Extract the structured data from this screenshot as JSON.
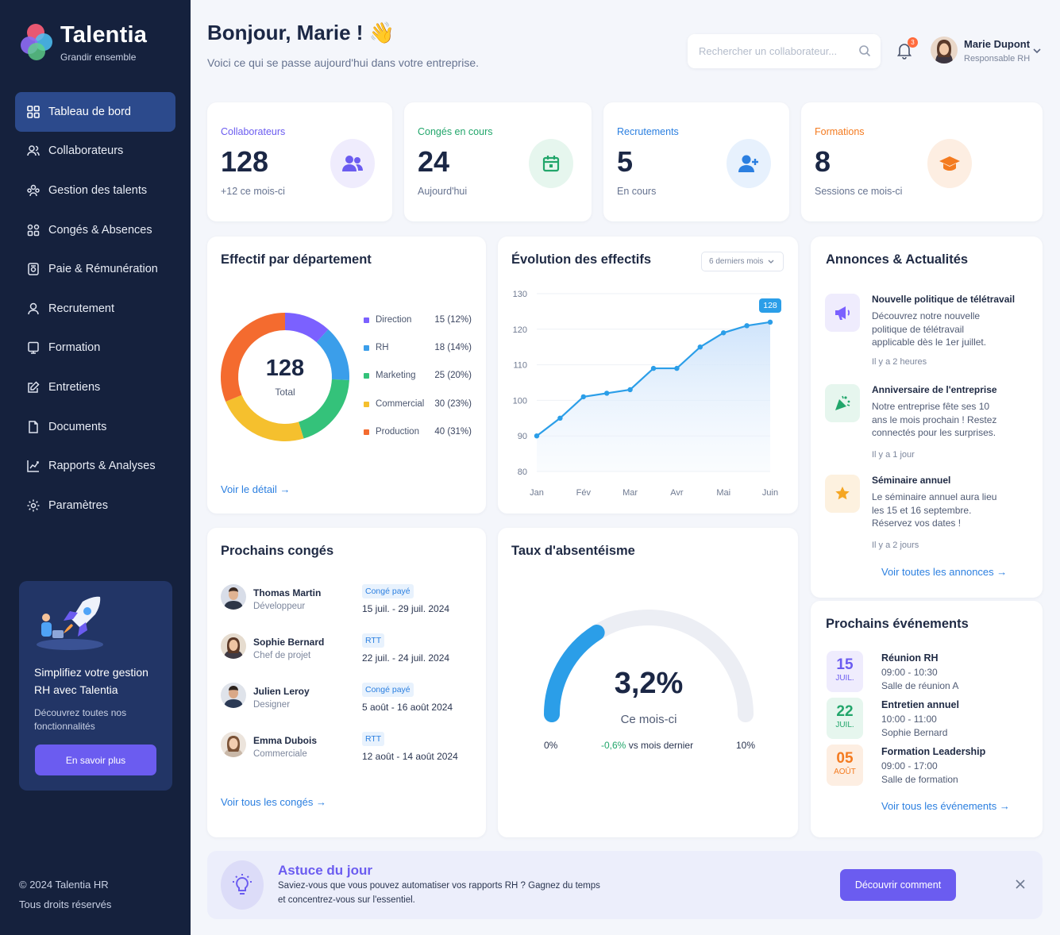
{
  "app": {
    "name": "Talentia",
    "tagline": "Grandir ensemble",
    "copyright": "© 2024 Talentia HR",
    "rights": "Tous droits réservés"
  },
  "colors": {
    "sidebar": "#15213d",
    "accent": "#6b5cf0",
    "link": "#2b7fe0",
    "positive": "#22a66b"
  },
  "nav": [
    {
      "label": "Tableau de bord",
      "icon": "grid-icon",
      "active": true
    },
    {
      "label": "Collaborateurs",
      "icon": "users-icon"
    },
    {
      "label": "Gestion des talents",
      "icon": "talents-icon"
    },
    {
      "label": "Congés & Absences",
      "icon": "calendar-grid-icon"
    },
    {
      "label": "Paie & Rémunération",
      "icon": "payroll-icon"
    },
    {
      "label": "Recrutement",
      "icon": "user-icon"
    },
    {
      "label": "Formation",
      "icon": "training-icon"
    },
    {
      "label": "Entretiens",
      "icon": "edit-icon"
    },
    {
      "label": "Documents",
      "icon": "document-icon"
    },
    {
      "label": "Rapports & Analyses",
      "icon": "report-icon"
    },
    {
      "label": "Paramètres",
      "icon": "gear-icon"
    }
  ],
  "promo": {
    "title": "Simplifiez votre gestion RH avec Talentia",
    "text": "Découvrez toutes nos fonctionnalités",
    "button": "En savoir plus"
  },
  "header": {
    "greeting": "Bonjour, Marie ! 👋",
    "subtitle": "Voici ce qui se passe aujourd'hui dans votre entreprise.",
    "search_placeholder": "Rechercher un collaborateur...",
    "notifications": "3",
    "user_name": "Marie Dupont",
    "user_role": "Responsable RH"
  },
  "stats": [
    {
      "label": "Collaborateurs",
      "value": "128",
      "sub": "+12 ce mois-ci",
      "color": "#6b5cf0",
      "bg": "#efecfd",
      "icon": "users-icon"
    },
    {
      "label": "Congés en cours",
      "value": "24",
      "sub": "Aujourd'hui",
      "color": "#22a66b",
      "bg": "#e6f6ee",
      "icon": "calendar-icon"
    },
    {
      "label": "Recrutements",
      "value": "5",
      "sub": "En cours",
      "color": "#2b7fe0",
      "bg": "#e7f1fd",
      "icon": "user-plus-icon"
    },
    {
      "label": "Formations",
      "value": "8",
      "sub": "Sessions ce mois-ci",
      "color": "#f47b20",
      "bg": "#fdeee2",
      "icon": "graduation-cap-icon"
    }
  ],
  "departments": {
    "title": "Effectif par département",
    "total": "128",
    "total_label": "Total",
    "link": "Voir le détail",
    "chart_data": {
      "type": "pie",
      "categories": [
        "Direction",
        "RH",
        "Marketing",
        "Commercial",
        "Production"
      ],
      "values": [
        15,
        18,
        25,
        30,
        40
      ],
      "labels": [
        "15 (12%)",
        "18 (14%)",
        "25 (20%)",
        "30 (23%)",
        "40 (31%)"
      ],
      "colors": [
        "#7b61ff",
        "#3b9eea",
        "#34c27a",
        "#f5c02e",
        "#f46b2f"
      ]
    }
  },
  "evolution": {
    "title": "Évolution des effectifs",
    "period": "6 derniers mois",
    "last_label": "128",
    "chart_data": {
      "type": "area",
      "x": [
        0,
        0.5,
        1,
        1.5,
        2,
        2.5,
        3,
        3.5,
        4,
        4.5,
        5
      ],
      "values": [
        90,
        95,
        101,
        102,
        103,
        109,
        109,
        115,
        119,
        121,
        122
      ],
      "xticks": [
        "Jan",
        "Fév",
        "Mar",
        "Avr",
        "Mai",
        "Juin"
      ],
      "yticks": [
        80,
        90,
        100,
        110,
        120,
        130
      ],
      "ylim": [
        80,
        130
      ]
    }
  },
  "news": {
    "title": "Annonces & Actualités",
    "link": "Voir toutes les annonces",
    "items": [
      {
        "title": "Nouvelle politique de télétravail",
        "text": "Découvrez notre nouvelle politique de télétravail applicable dès le 1er juillet.",
        "ago": "Il y a 2 heures",
        "icon": "megaphone-icon",
        "color": "#7b61ff",
        "bg": "#efecfd"
      },
      {
        "title": "Anniversaire de l'entreprise",
        "text": "Notre entreprise fête ses 10 ans le mois prochain ! Restez connectés pour les surprises.",
        "ago": "Il y a 1 jour",
        "icon": "party-icon",
        "color": "#22a66b",
        "bg": "#e6f6ee"
      },
      {
        "title": "Séminaire annuel",
        "text": "Le séminaire annuel aura lieu les 15 et 16 septembre. Réservez vos dates !",
        "ago": "Il y a 2 jours",
        "icon": "star-icon",
        "color": "#f5a623",
        "bg": "#fdf1df"
      }
    ]
  },
  "leaves": {
    "title": "Prochains congés",
    "link": "Voir tous les congés",
    "items": [
      {
        "name": "Thomas Martin",
        "role": "Développeur",
        "type": "Congé payé",
        "dates": "15 juil. - 29 juil. 2024"
      },
      {
        "name": "Sophie Bernard",
        "role": "Chef de projet",
        "type": "RTT",
        "dates": "22 juil. - 24 juil. 2024"
      },
      {
        "name": "Julien Leroy",
        "role": "Designer",
        "type": "Congé payé",
        "dates": "5 août - 16 août 2024"
      },
      {
        "name": "Emma Dubois",
        "role": "Commerciale",
        "type": "RTT",
        "dates": "12 août - 14 août 2024"
      }
    ]
  },
  "absence": {
    "title": "Taux d'absentéisme",
    "value": "3,2%",
    "value_num": 3.2,
    "max": 10,
    "sub": "Ce mois-ci",
    "min_label": "0%",
    "max_label": "10%",
    "delta": "-0,6%",
    "delta_text": "vs mois dernier"
  },
  "events": {
    "title": "Prochains événements",
    "link": "Voir tous les événements",
    "items": [
      {
        "day": "15",
        "month": "JUIL.",
        "title": "Réunion RH",
        "hours": "09:00 - 10:30",
        "place": "Salle de réunion A",
        "color": "#6b5cf0",
        "bg": "#efecfd"
      },
      {
        "day": "22",
        "month": "JUIL.",
        "title": "Entretien annuel",
        "hours": "10:00 - 11:00",
        "place": "Sophie Bernard",
        "color": "#22a66b",
        "bg": "#e6f6ee"
      },
      {
        "day": "05",
        "month": "AOÛT",
        "title": "Formation Leadership",
        "hours": "09:00 - 17:00",
        "place": "Salle de formation",
        "color": "#f47b20",
        "bg": "#fdeee2"
      }
    ]
  },
  "tip": {
    "title": "Astuce du jour",
    "line1": "Saviez-vous que vous pouvez automatiser vos rapports RH ? Gagnez du temps",
    "line2": "et concentrez-vous sur l'essentiel.",
    "button": "Découvrir comment"
  }
}
